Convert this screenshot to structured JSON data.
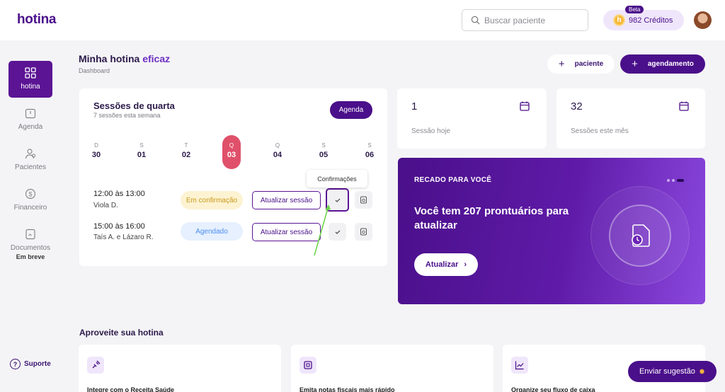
{
  "app": {
    "logo": "hotina"
  },
  "header": {
    "search_placeholder": "Buscar paciente",
    "credits_label": "982 Créditos",
    "credits_coin": "h",
    "beta_badge": "Beta"
  },
  "sidebar": {
    "items": [
      {
        "label": "hotina",
        "icon": "grid-icon"
      },
      {
        "label": "Agenda",
        "icon": "calendar-icon"
      },
      {
        "label": "Pacientes",
        "icon": "users-icon"
      },
      {
        "label": "Financeiro",
        "icon": "dollar-icon"
      },
      {
        "label": "Documentos",
        "sub": "Em breve",
        "icon": "document-icon"
      }
    ],
    "support_label": "Suporte",
    "support_glyph": "?"
  },
  "page": {
    "title_main": "Minha hotina",
    "title_accent": "eficaz",
    "subtitle": "Dashboard",
    "btn_paciente": "paciente",
    "btn_agendamento": "agendamento",
    "plus_glyph": "+"
  },
  "sessions": {
    "title": "Sessões de quarta",
    "subtitle": "7 sessões esta semana",
    "agenda_button": "Agenda",
    "days": [
      {
        "letter": "D",
        "num": "30"
      },
      {
        "letter": "S",
        "num": "01"
      },
      {
        "letter": "T",
        "num": "02"
      },
      {
        "letter": "Q",
        "num": "03"
      },
      {
        "letter": "Q",
        "num": "04"
      },
      {
        "letter": "S",
        "num": "05"
      },
      {
        "letter": "S",
        "num": "06"
      }
    ],
    "rows": [
      {
        "time": "12:00 às 13:00",
        "name": "Viola D.",
        "status": "Em confirmação",
        "action": "Atualizar sessão"
      },
      {
        "time": "15:00 às 16:00",
        "name": "Taís A. e Lázaro R.",
        "status": "Agendado",
        "action": "Atualizar sessão"
      }
    ],
    "tooltip": "Confirmações"
  },
  "stats": [
    {
      "value": "1",
      "label": "Sessão hoje"
    },
    {
      "value": "32",
      "label": "Sessões este mês"
    }
  ],
  "promo": {
    "kicker": "RECADO PARA VOCÊ",
    "title": "Você tem 207 prontuários para atualizar",
    "button": "Atualizar",
    "button_glyph": "›"
  },
  "features": {
    "section_title": "Aproveite sua hotina",
    "cards": [
      {
        "text": "Integre com o Receita Saúde",
        "icon": "plug-icon"
      },
      {
        "text": "Emita notas fiscais mais rápido",
        "icon": "receipt-icon"
      },
      {
        "text": "Organize seu fluxo de caixa",
        "icon": "chart-line-icon"
      }
    ]
  },
  "suggest_button": "Enviar sugestão",
  "suggest_glyph": "✸",
  "colors": {
    "primary": "#4a0f8a",
    "accent": "#6e2fc4",
    "today": "#e0506a"
  }
}
